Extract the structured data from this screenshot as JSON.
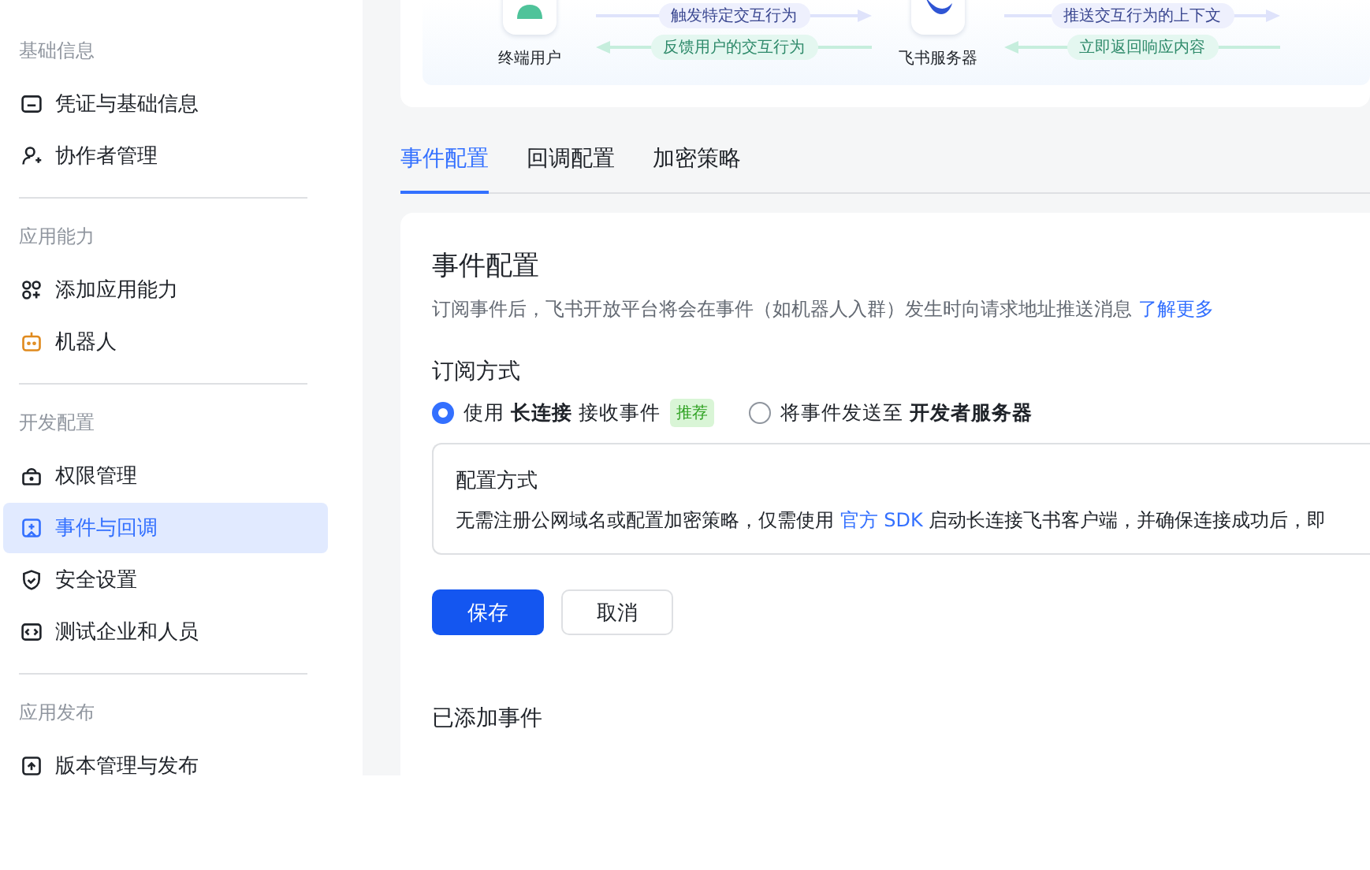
{
  "sidebar": {
    "groups": [
      {
        "title": "基础信息",
        "items": [
          {
            "label": "凭证与基础信息",
            "selected": false
          },
          {
            "label": "协作者管理",
            "selected": false
          }
        ]
      },
      {
        "title": "应用能力",
        "items": [
          {
            "label": "添加应用能力",
            "selected": false
          },
          {
            "label": "机器人",
            "selected": false
          }
        ]
      },
      {
        "title": "开发配置",
        "items": [
          {
            "label": "权限管理",
            "selected": false
          },
          {
            "label": "事件与回调",
            "selected": true
          },
          {
            "label": "安全设置",
            "selected": false
          },
          {
            "label": "测试企业和人员",
            "selected": false
          }
        ]
      },
      {
        "title": "应用发布",
        "items": [
          {
            "label": "版本管理与发布",
            "selected": false
          }
        ]
      }
    ]
  },
  "diagram": {
    "nodes": [
      "终端用户",
      "飞书服务器"
    ],
    "forward": [
      "触发特定交互行为",
      "推送交互行为的上下文"
    ],
    "back": [
      "反馈用户的交互行为",
      "立即返回响应内容"
    ]
  },
  "tabs": [
    {
      "label": "事件配置",
      "selected": true
    },
    {
      "label": "回调配置",
      "selected": false
    },
    {
      "label": "加密策略",
      "selected": false
    }
  ],
  "panel": {
    "title": "事件配置",
    "description": "订阅事件后，飞书开放平台将会在事件（如机器人入群）发生时向请求地址推送消息",
    "description_link": "了解更多",
    "subscription": {
      "title": "订阅方式",
      "options": [
        {
          "label": "使用 **长连接** 接收事件",
          "badge": "推荐",
          "selected": true
        },
        {
          "label": "将事件发送至 **开发者服务器**",
          "selected": false
        }
      ]
    },
    "config": {
      "title": "配置方式",
      "text_before": "无需注册公网域名或配置加密策略，仅需使用",
      "link": "官方 SDK",
      "text_after": "启动长连接飞书客户端，并确保连接成功后，即"
    },
    "buttons": {
      "save": "保存",
      "cancel": "取消"
    },
    "added_events_title": "已添加事件"
  }
}
